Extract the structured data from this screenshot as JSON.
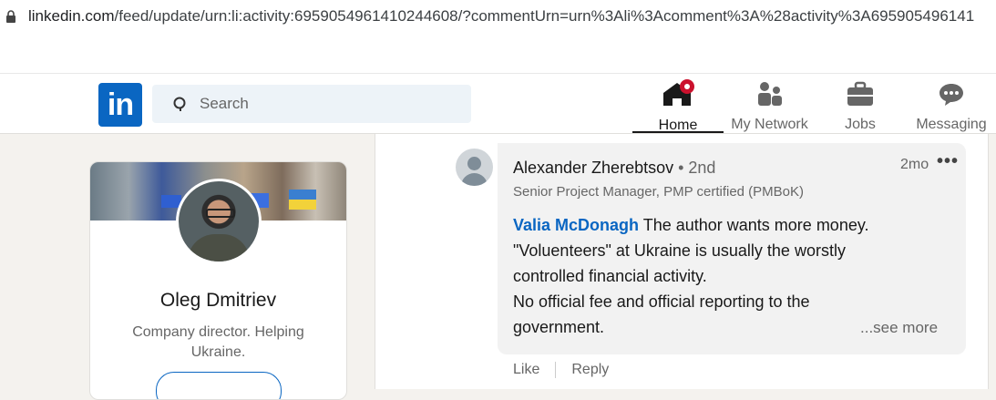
{
  "browser": {
    "url_host": "linkedin.com",
    "url_rest": "/feed/update/urn:li:activity:6959054961410244608/?commentUrn=urn%3Ali%3Acomment%3A%28activity%3A695905496141"
  },
  "nav": {
    "logo": "in",
    "search_placeholder": "Search",
    "items": [
      {
        "label": "Home",
        "icon": "home-icon",
        "active": true,
        "badge": true
      },
      {
        "label": "My Network",
        "icon": "network-icon",
        "active": false
      },
      {
        "label": "Jobs",
        "icon": "briefcase-icon",
        "active": false
      },
      {
        "label": "Messaging",
        "icon": "messaging-icon",
        "active": false
      }
    ]
  },
  "profile": {
    "name": "Oleg Dmitriev",
    "headline": "Company director. Helping Ukraine."
  },
  "comment": {
    "author": "Alexander Zherebtsov",
    "degree": " • 2nd",
    "time": "2mo",
    "more": "•••",
    "author_title": "Senior Project Manager, PMP certified (PMBoK)",
    "mention": "Valia McDonagh",
    "line1": " The author wants more money.",
    "line2": "\"Voluenteers\" at Ukraine is usually the worstly",
    "line3": "controlled financial activity.",
    "line4": "No official fee and official reporting to the",
    "line5": "government.",
    "see_more": "...see more",
    "like": "Like",
    "reply": "Reply"
  },
  "colors": {
    "brand": "#0a66c2",
    "badge": "#cb112d",
    "background": "#f4f2ee"
  }
}
